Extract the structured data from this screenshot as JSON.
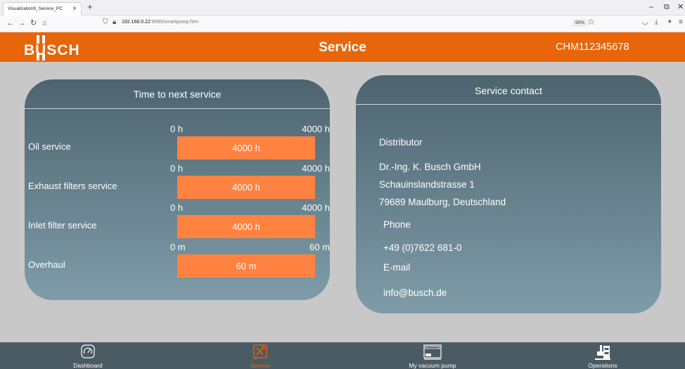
{
  "browser": {
    "tab_title": "Visualization9_Service_PC",
    "tab_close": "×",
    "new_tab": "+",
    "url_host": "192.168.0.22",
    "url_rest": ":8080/smartpump.htm",
    "zoom": "90%"
  },
  "header": {
    "logo": "BUSCH",
    "title": "Service",
    "serial": "CHM112345678"
  },
  "time_panel": {
    "title": "Time to next service",
    "rows": [
      {
        "label": "Oil service",
        "min": "0 h",
        "max": "4000 h",
        "value": "4000 h",
        "fill_fraction": 1.0
      },
      {
        "label": "Exhaust filters service",
        "min": "0 h",
        "max": "4000 h",
        "value": "4000 h",
        "fill_fraction": 1.0
      },
      {
        "label": "Inlet filter service",
        "min": "0 h",
        "max": "4000 h",
        "value": "4000 h",
        "fill_fraction": 1.0
      },
      {
        "label": "Overhaul",
        "min": "0 m",
        "max": "60 m",
        "value": "60 m",
        "fill_fraction": 1.0
      }
    ]
  },
  "contact_panel": {
    "title": "Service contact",
    "distributor_label": "Distributor",
    "company": "Dr.-Ing. K. Busch GmbH",
    "street": "Schauinslandstrasse 1",
    "city": "79689 Maulburg, Deutschland",
    "phone_label": "Phone",
    "phone": "+49 (0)7622 681-0",
    "email_label": "E-mail",
    "email": "info@busch.de"
  },
  "bottom_nav": {
    "items": [
      {
        "label": "Dashboard",
        "icon": "speedometer-icon"
      },
      {
        "label": "Service",
        "icon": "tools-icon",
        "active": true
      },
      {
        "label": "My vacuum pump",
        "icon": "pump-icon"
      },
      {
        "label": "Operations",
        "icon": "operations-icon"
      }
    ]
  },
  "colors": {
    "brand_orange": "#e8650a",
    "bar_fill": "#ff8240",
    "panel_top": "#4d6470",
    "panel_bottom": "#7f9ca8",
    "nav_bg": "#4b5b63"
  }
}
